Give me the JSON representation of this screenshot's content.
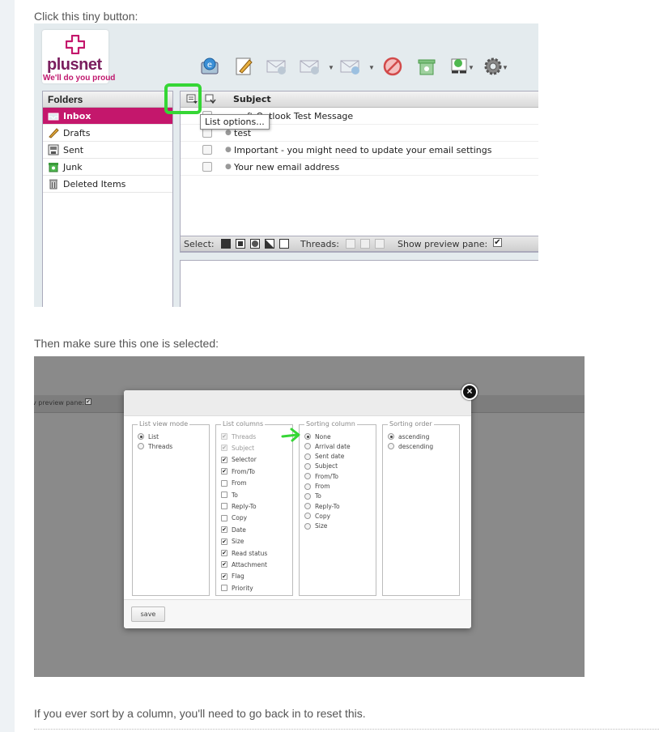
{
  "captions": {
    "first": "Click this tiny button:",
    "second": "Then make sure this one is selected:",
    "third": "If you ever sort by a column, you'll need to go back in to reset this."
  },
  "shot1": {
    "brand": {
      "name": "plusnet",
      "tagline": "We'll do you proud",
      "color": "#7a1e5e",
      "accent": "#c4176c"
    },
    "toolbar_icons": [
      "refresh-icon",
      "compose-icon",
      "reply-icon",
      "reply-all-icon",
      "forward-icon",
      "delete-icon",
      "junk-icon",
      "mark-icon",
      "settings-icon"
    ],
    "folders": {
      "header": "Folders",
      "items": [
        {
          "label": "Inbox",
          "icon": "inbox-icon",
          "active": true
        },
        {
          "label": "Drafts",
          "icon": "pencil-icon"
        },
        {
          "label": "Sent",
          "icon": "sent-icon"
        },
        {
          "label": "Junk",
          "icon": "junk-icon"
        },
        {
          "label": "Deleted Items",
          "icon": "trash-icon"
        }
      ]
    },
    "list": {
      "subject_header": "Subject",
      "tooltip": "List options...",
      "messages": [
        {
          "subject": "ft Outlook Test Message"
        },
        {
          "subject": "test"
        },
        {
          "subject": "Important - you might need to update your email settings"
        },
        {
          "subject": "Your new email address"
        }
      ]
    },
    "selectbar": {
      "select_label": "Select:",
      "threads_label": "Threads:",
      "preview_label": "Show preview pane:",
      "check": "✔"
    }
  },
  "shot2": {
    "bg_preview_label": "v preview pane:",
    "check": "✔",
    "list_view_mode": {
      "legend": "List view mode",
      "options": [
        {
          "label": "List",
          "selected": true
        },
        {
          "label": "Threads",
          "selected": false
        }
      ]
    },
    "list_columns": {
      "legend": "List columns",
      "options": [
        {
          "label": "Threads",
          "checked": true,
          "disabled": true
        },
        {
          "label": "Subject",
          "checked": true,
          "disabled": true
        },
        {
          "label": "Selector",
          "checked": true
        },
        {
          "label": "From/To",
          "checked": true
        },
        {
          "label": "From",
          "checked": false
        },
        {
          "label": "To",
          "checked": false
        },
        {
          "label": "Reply-To",
          "checked": false
        },
        {
          "label": "Copy",
          "checked": false
        },
        {
          "label": "Date",
          "checked": true
        },
        {
          "label": "Size",
          "checked": true
        },
        {
          "label": "Read status",
          "checked": true
        },
        {
          "label": "Attachment",
          "checked": true
        },
        {
          "label": "Flag",
          "checked": true
        },
        {
          "label": "Priority",
          "checked": false
        }
      ]
    },
    "sorting_column": {
      "legend": "Sorting column",
      "options": [
        {
          "label": "None",
          "selected": true
        },
        {
          "label": "Arrival date",
          "selected": false
        },
        {
          "label": "Sent date",
          "selected": false
        },
        {
          "label": "Subject",
          "selected": false
        },
        {
          "label": "From/To",
          "selected": false
        },
        {
          "label": "From",
          "selected": false
        },
        {
          "label": "To",
          "selected": false
        },
        {
          "label": "Reply-To",
          "selected": false
        },
        {
          "label": "Copy",
          "selected": false
        },
        {
          "label": "Size",
          "selected": false
        }
      ]
    },
    "sorting_order": {
      "legend": "Sorting order",
      "options": [
        {
          "label": "ascending",
          "selected": true
        },
        {
          "label": "descending",
          "selected": false
        }
      ]
    },
    "save_label": "save",
    "close_glyph": "×",
    "highlight_color": "#35d635"
  }
}
